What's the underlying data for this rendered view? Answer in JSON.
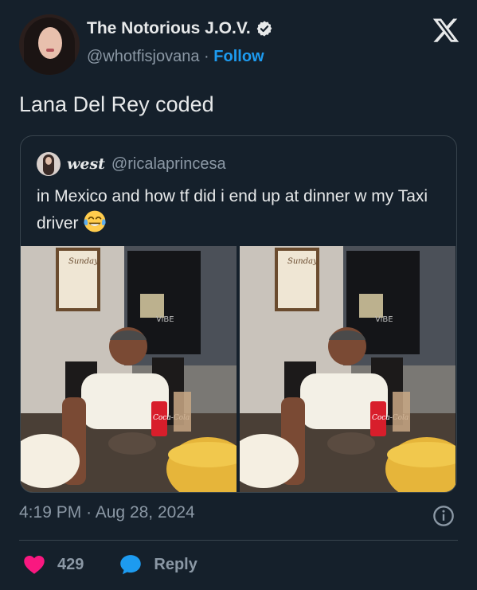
{
  "author": {
    "name": "The Notorious J.O.V.",
    "handle": "@whotfisjovana",
    "separator": "·",
    "follow_label": "Follow"
  },
  "tweet_text": "Lana Del Rey coded",
  "quoted": {
    "name": "west",
    "handle": "@ricalaprincesa",
    "text": "in Mexico and how tf did i end up at dinner w my Taxi driver",
    "emoji": "😂"
  },
  "photo_items": {
    "sign_text": "Sunday",
    "tv_text": "ViBE",
    "can_text": "Coca-Cola"
  },
  "timestamp": {
    "time": "4:19 PM",
    "separator": "·",
    "date": "Aug 28, 2024"
  },
  "actions": {
    "like_count": "429",
    "reply_label": "Reply"
  },
  "colors": {
    "background": "#15202b",
    "accent": "#1d9bf0",
    "like": "#f91880",
    "muted": "#8b98a5"
  },
  "icons": [
    "verified-icon",
    "x-logo-icon",
    "info-icon",
    "heart-icon",
    "reply-icon"
  ]
}
